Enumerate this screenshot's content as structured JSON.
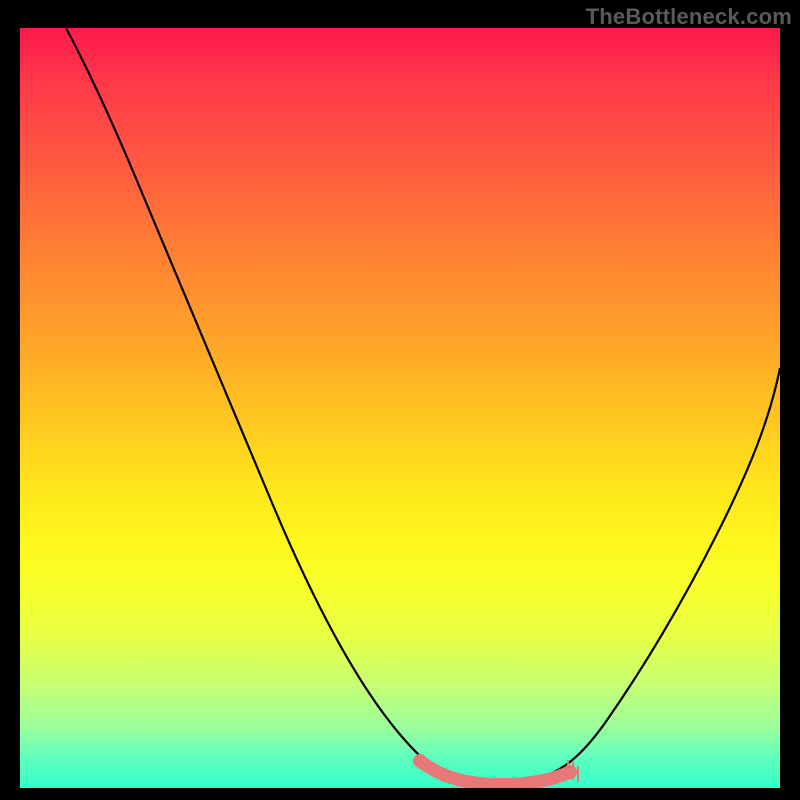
{
  "watermark": "TheBottleneck.com",
  "chart_data": {
    "type": "line",
    "title": "",
    "xlabel": "",
    "ylabel": "",
    "xlim": [
      0,
      100
    ],
    "ylim": [
      0,
      100
    ],
    "grid": false,
    "series": [
      {
        "name": "curve",
        "color": "#000000",
        "x": [
          6,
          10,
          15,
          20,
          25,
          30,
          35,
          40,
          45,
          50,
          53,
          56,
          59,
          62,
          65,
          68,
          71,
          73,
          76,
          80,
          84,
          88,
          92,
          96,
          100
        ],
        "y": [
          100,
          93,
          85,
          77,
          69,
          60,
          51,
          42,
          33,
          24,
          18,
          12,
          7,
          3,
          1,
          0.5,
          0.5,
          1,
          3,
          8,
          15,
          24,
          34,
          45,
          56
        ]
      }
    ],
    "highlight": {
      "name": "bottom-marker",
      "color": "#e87777",
      "approx_x_range": [
        55,
        73
      ],
      "approx_y_range": [
        0,
        6
      ]
    },
    "background_gradient": {
      "stops": [
        {
          "pos": 0,
          "color": "#ff1a4d"
        },
        {
          "pos": 50,
          "color": "#ffc820"
        },
        {
          "pos": 70,
          "color": "#fff81e"
        },
        {
          "pos": 100,
          "color": "#33ffc9"
        }
      ]
    }
  }
}
